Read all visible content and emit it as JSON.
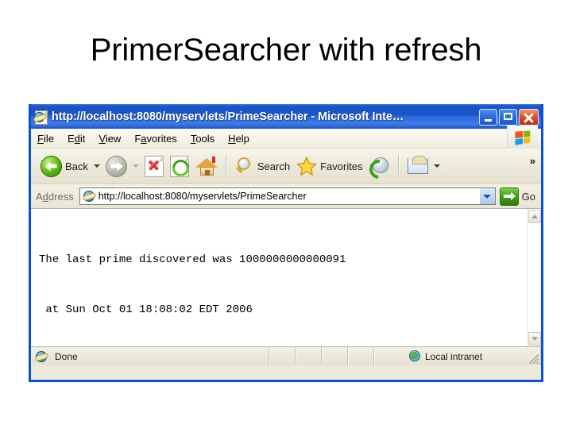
{
  "slide": {
    "title": "PrimerSearcher with refresh"
  },
  "browser": {
    "window_title": "http://localhost:8080/myservlets/PrimeSearcher - Microsoft Inte…",
    "window_controls": {
      "minimize": "Minimize",
      "maximize": "Maximize",
      "close": "Close"
    },
    "menu": [
      {
        "pre": "",
        "accel": "F",
        "post": "ile"
      },
      {
        "pre": "E",
        "accel": "d",
        "post": "it"
      },
      {
        "pre": "",
        "accel": "V",
        "post": "iew"
      },
      {
        "pre": "F",
        "accel": "a",
        "post": "vorites"
      },
      {
        "pre": "",
        "accel": "T",
        "post": "ools"
      },
      {
        "pre": "",
        "accel": "H",
        "post": "elp"
      }
    ],
    "toolbar": {
      "back_label": "Back",
      "forward_label": "",
      "stop_label": "",
      "refresh_label": "",
      "home_label": "",
      "search_label": "Search",
      "favorites_label": "Favorites",
      "media_label": "",
      "mail_label": "",
      "overflow_label": "»"
    },
    "address": {
      "label_pre": "A",
      "label_accel": "d",
      "label_post": "dress",
      "value": "http://localhost:8080/myservlets/PrimeSearcher",
      "go_label": "Go"
    },
    "page": {
      "line1": "The last prime discovered was 1000000000000091",
      "line2": " at Sun Oct 01 18:08:02 EDT 2006"
    },
    "status": {
      "left": "Done",
      "zone": "Local intranet"
    }
  },
  "colors": {
    "titlebar_blue": "#1b54c8",
    "frame_blue": "#0a50d2",
    "chrome_beige": "#ece9d8",
    "go_green": "#3f9e18",
    "close_red": "#e4502a"
  }
}
